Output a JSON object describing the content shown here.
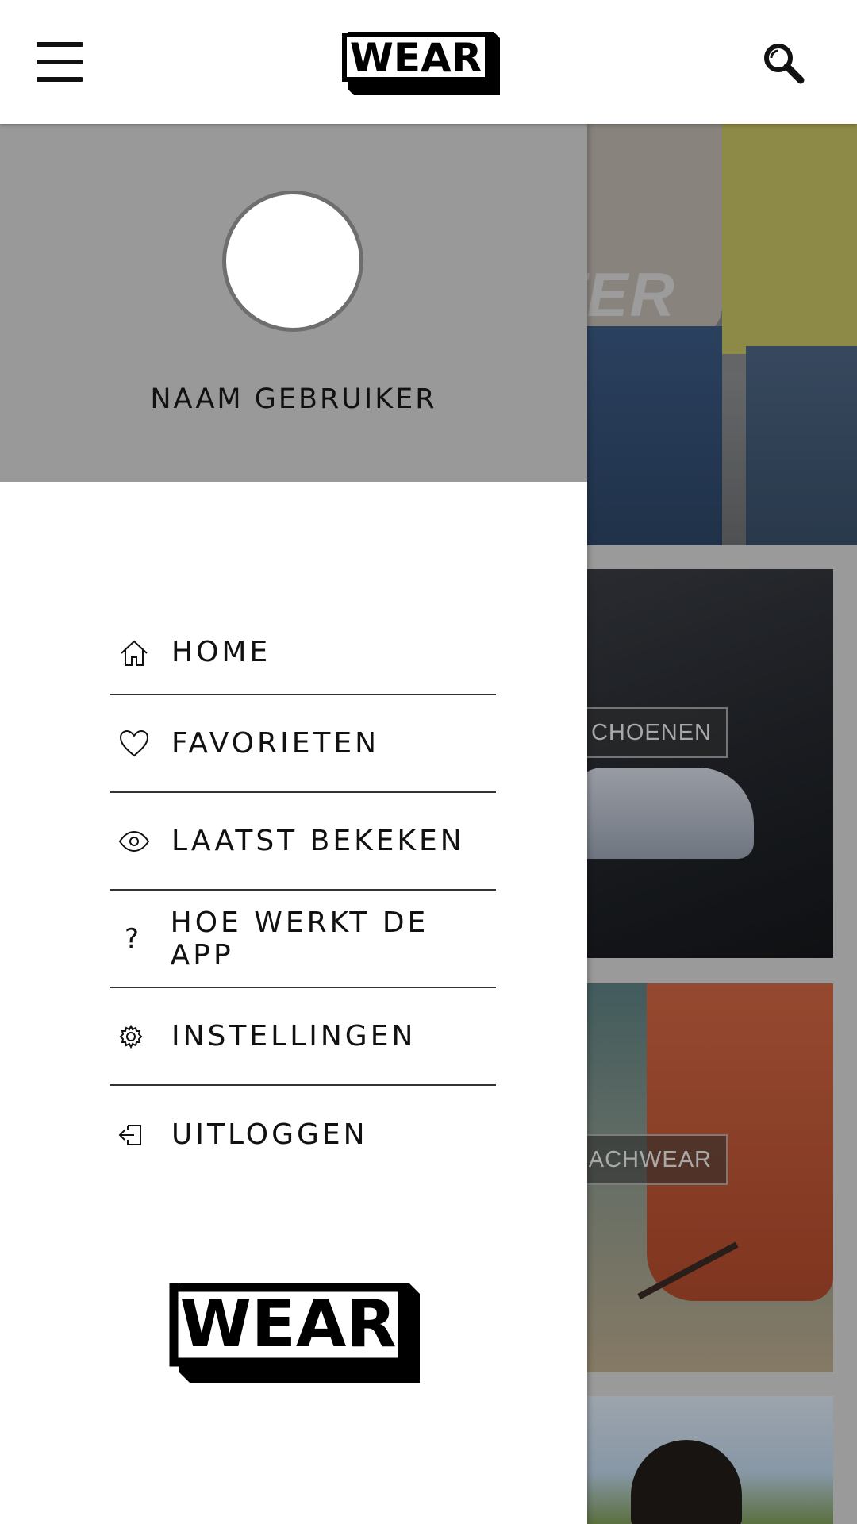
{
  "topbar": {
    "logo_text": "WEAR",
    "menu_icon": "hamburger-menu-icon",
    "search_icon": "search-icon"
  },
  "background": {
    "hero_text": "TER",
    "tiles": [
      {
        "label": "CHOENEN"
      },
      {
        "label": "EACHWEAR"
      },
      {
        "label": ""
      }
    ]
  },
  "drawer": {
    "username": "NAAM GEBRUIKER",
    "items": [
      {
        "label": "HOME",
        "icon": "home-icon"
      },
      {
        "label": "FAVORIETEN",
        "icon": "heart-icon"
      },
      {
        "label": "LAATST BEKEKEN",
        "icon": "eye-icon"
      },
      {
        "label": "HOE WERKT DE APP",
        "icon": "question-icon",
        "glyph": "?"
      },
      {
        "label": "INSTELLINGEN",
        "icon": "gear-icon"
      },
      {
        "label": "UITLOGGEN",
        "icon": "logout-icon"
      }
    ],
    "logo_text": "WEAR"
  },
  "colors": {
    "drawer_header": "#999999",
    "topbar": "#ffffff",
    "text": "#111111"
  }
}
